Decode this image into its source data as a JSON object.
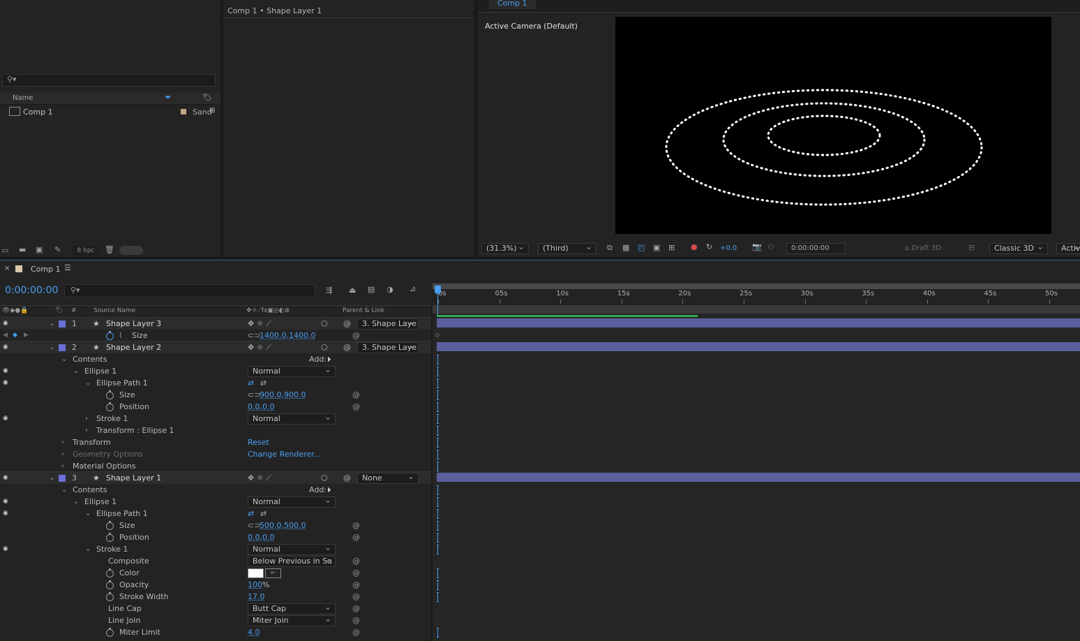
{
  "project": {
    "search_placeholder": "",
    "col_name": "Name",
    "item_name": "Comp 1",
    "item_type": "Sand",
    "bpc": "8 bpc"
  },
  "layer_panel": {
    "title": "Comp 1 • Shape Layer 1"
  },
  "viewer": {
    "tab": "Comp 1",
    "camera_label": "Active Camera (Default)",
    "zoom": "(31.3%)",
    "resolution": "(Third)",
    "exposure": "+0.0",
    "timecode": "0:00:00:00",
    "draft3d": "Draft 3D",
    "renderer": "Classic 3D",
    "view": "Active"
  },
  "timeline": {
    "tab": "Comp 1",
    "current_time": "0:00:00:00",
    "search_placeholder": "",
    "col_num": "#",
    "col_source": "Source Name",
    "col_parent": "Parent & Link",
    "ruler": [
      "0s",
      "05s",
      "10s",
      "15s",
      "20s",
      "25s",
      "30s",
      "35s",
      "40s",
      "45s",
      "50s"
    ],
    "rows": {
      "l3_num": "1",
      "l3_name": "Shape Layer 3",
      "l3_parent": "3. Shape Laye",
      "l3_size_label": "Size",
      "l3_size_val": "1400.0,1400.0",
      "l2_num": "2",
      "l2_name": "Shape Layer 2",
      "l2_parent": "3. Shape Laye",
      "contents": "Contents",
      "add": "Add:",
      "ellipse1": "Ellipse 1",
      "blend_normal": "Normal",
      "ellipse_path1": "Ellipse Path 1",
      "size": "Size",
      "l2_size_val": "900.0,900.0",
      "position": "Position",
      "pos_val": "0.0,0.0",
      "stroke1": "Stroke 1",
      "transform_ellipse1": "Transform : Ellipse 1",
      "transform": "Transform",
      "reset": "Reset",
      "geometry_options": "Geometry Options",
      "change_renderer": "Change Renderer...",
      "material_options": "Material Options",
      "l1_num": "3",
      "l1_name": "Shape Layer 1",
      "l1_parent": "None",
      "l1_size_val": "500.0,500.0",
      "composite": "Composite",
      "composite_val": "Below Previous in Sa",
      "color": "Color",
      "opacity": "Opacity",
      "opacity_val": "100",
      "opacity_unit": "%",
      "stroke_width": "Stroke Width",
      "stroke_width_val": "17.0",
      "line_cap": "Line Cap",
      "line_cap_val": "Butt Cap",
      "line_join": "Line Join",
      "line_join_val": "Miter Join",
      "miter_limit": "Miter Limit",
      "miter_limit_val": "4.0"
    }
  },
  "colors": {
    "accent_blue": "#4a9df0",
    "layer_label": "#6a6fd8",
    "bar_fill": "#5b5f9e",
    "work_area": "#2fa84f"
  }
}
